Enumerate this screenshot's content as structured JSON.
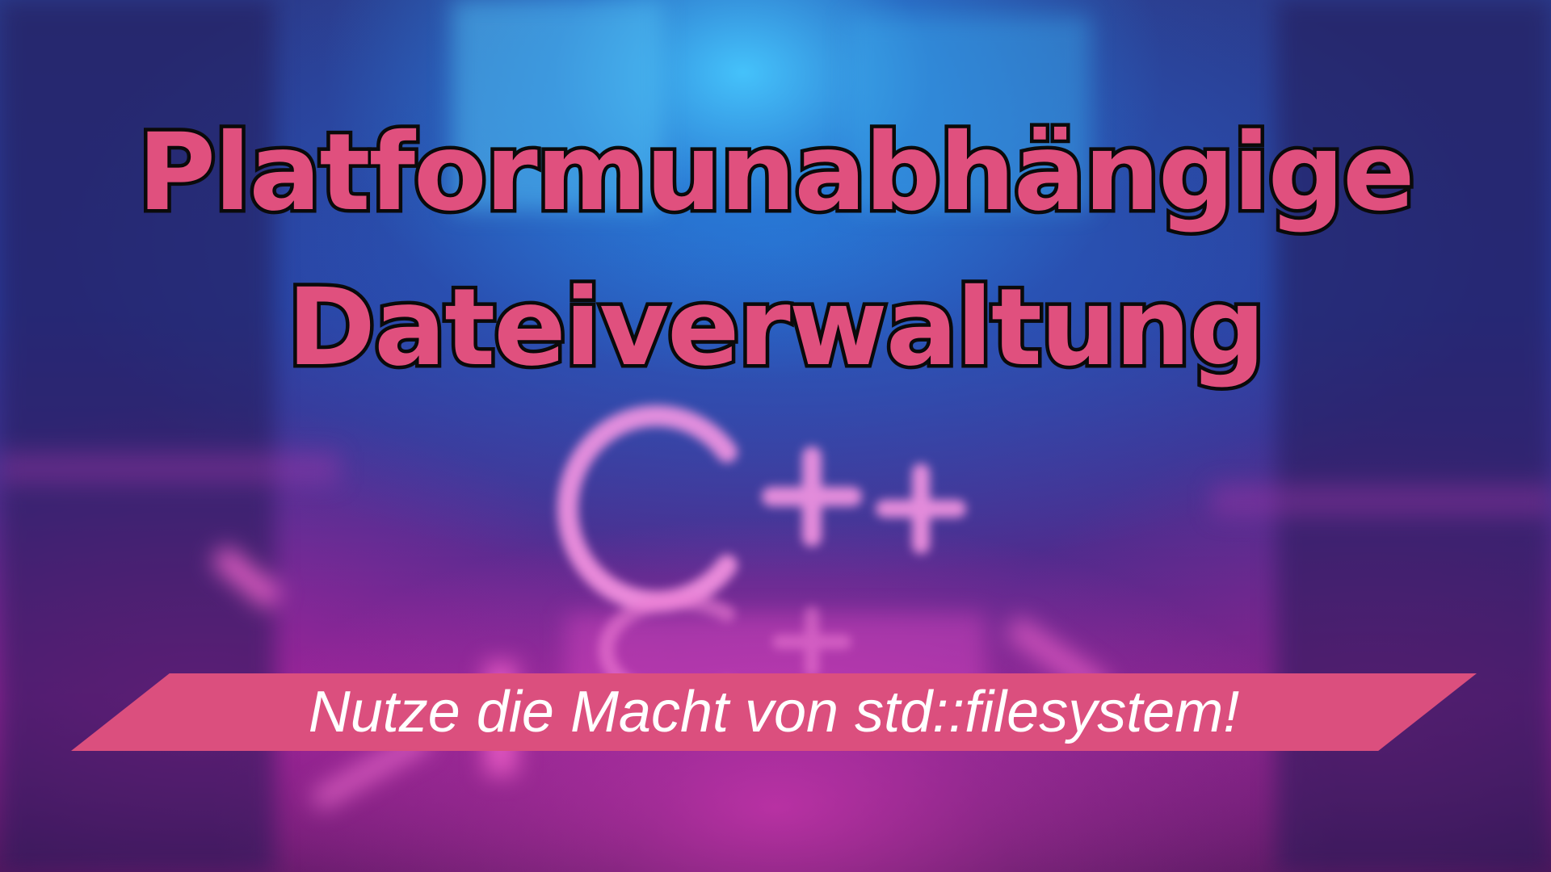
{
  "title": {
    "line1": "Platformunabhängige",
    "line2": "Dateiverwaltung"
  },
  "banner": {
    "text": "Nutze die Macht von std::filesystem!"
  },
  "background": {
    "icon": "cpp-logo-icon",
    "colors": {
      "top": "#46c8ff",
      "middle": "#2a3a9a",
      "bottom": "#c83cb4"
    }
  },
  "colors": {
    "title_fill": "#e0507e",
    "title_outline": "#0b0b0b",
    "banner_fill": "#db4f7e",
    "banner_text": "#ffffff"
  }
}
